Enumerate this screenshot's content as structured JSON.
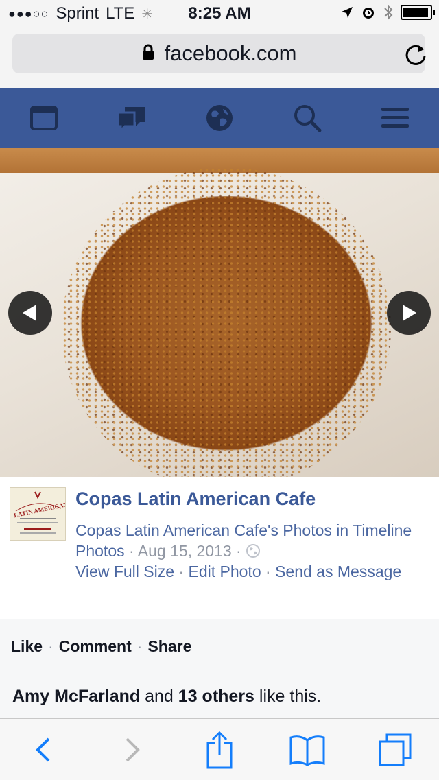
{
  "status": {
    "signal": "●●●○○",
    "carrier": "Sprint",
    "network": "LTE",
    "time": "8:25 AM"
  },
  "browser": {
    "url": "facebook.com"
  },
  "fb_nav": {
    "icons": [
      "news-feed-icon",
      "messages-icon",
      "notifications-globe-icon",
      "search-icon",
      "menu-icon"
    ],
    "color": "#3b5998"
  },
  "photo": {
    "prev_icon": "arrow-left-icon",
    "next_icon": "arrow-right-icon"
  },
  "post": {
    "thumbnail_text": "LATIN AMERICAN",
    "page_name": "Copas Latin American Cafe",
    "album_text": "Copas Latin American Cafe's Photos in Timeline Photos",
    "date": "Aug 15, 2013",
    "view_full_size": "View Full Size",
    "edit_photo": "Edit Photo",
    "send_as_message": "Send as Message"
  },
  "actions": {
    "like": "Like",
    "comment": "Comment",
    "share": "Share"
  },
  "likes": {
    "name": "Amy McFarland",
    "and": "and",
    "others": "13 others",
    "suffix": "like this."
  },
  "toolbar": {
    "icons": [
      "back-icon",
      "forward-icon",
      "share-icon",
      "bookmarks-icon",
      "tabs-icon"
    ],
    "accent": "#147efb"
  }
}
